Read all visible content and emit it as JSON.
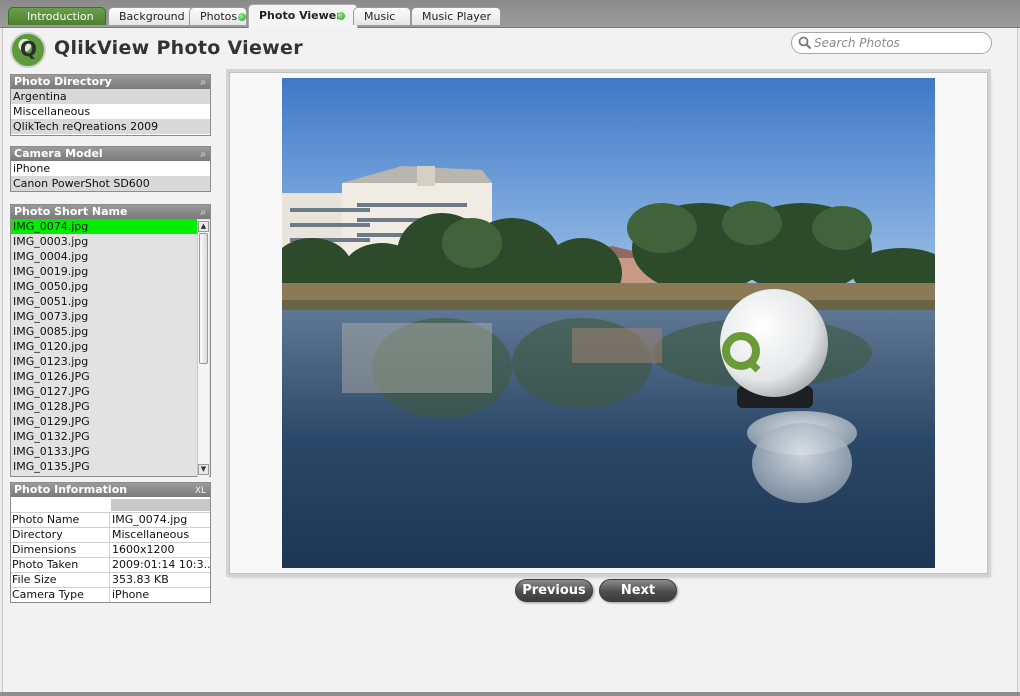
{
  "tabs": [
    {
      "label": "Introduction"
    },
    {
      "label": "Background"
    },
    {
      "label": "Photos"
    },
    {
      "label": "Photo Viewer"
    },
    {
      "label": "Music"
    },
    {
      "label": "Music Player"
    }
  ],
  "header": {
    "title": "QlikView Photo Viewer",
    "logo_letter": "Q"
  },
  "search": {
    "placeholder": "Search Photos",
    "value": ""
  },
  "photo_directory": {
    "title": "Photo Directory",
    "items": [
      "Argentina",
      "Miscellaneous",
      "QlikTech reQreations 2009"
    ]
  },
  "camera_model": {
    "title": "Camera Model",
    "items": [
      "iPhone",
      "Canon PowerShot SD600"
    ]
  },
  "photo_short_name": {
    "title": "Photo Short Name",
    "selected": "IMG_0074.jpg",
    "items": [
      "IMG_0074.jpg",
      "IMG_0003.jpg",
      "IMG_0004.jpg",
      "IMG_0019.jpg",
      "IMG_0050.jpg",
      "IMG_0051.jpg",
      "IMG_0073.jpg",
      "IMG_0085.jpg",
      "IMG_0120.jpg",
      "IMG_0123.jpg",
      "IMG_0126.JPG",
      "IMG_0127.JPG",
      "IMG_0128.JPG",
      "IMG_0129.JPG",
      "IMG_0132.JPG",
      "IMG_0133.JPG",
      "IMG_0135.JPG"
    ]
  },
  "photo_information": {
    "title": "Photo Information",
    "xl_label": "XL",
    "rows": [
      {
        "label": "Photo Name",
        "value": "IMG_0074.jpg"
      },
      {
        "label": "Directory",
        "value": "Miscellaneous"
      },
      {
        "label": "Dimensions",
        "value": "1600x1200"
      },
      {
        "label": "Photo Taken",
        "value": "2009:01:14 10:3..."
      },
      {
        "label": "File Size",
        "value": "353.83 KB"
      },
      {
        "label": "Camera Type",
        "value": "iPhone"
      }
    ]
  },
  "navigation": {
    "previous_label": "Previous",
    "next_label": "Next"
  },
  "icons": {
    "search": "search-icon",
    "listbox_search": "search-icon",
    "scroll_up": "arrow-up-icon",
    "scroll_down": "arrow-down-icon"
  },
  "colors": {
    "selected": "#00ee00",
    "intro_tab": "#5a8f3c",
    "title_bar": "#8a8a8a"
  }
}
